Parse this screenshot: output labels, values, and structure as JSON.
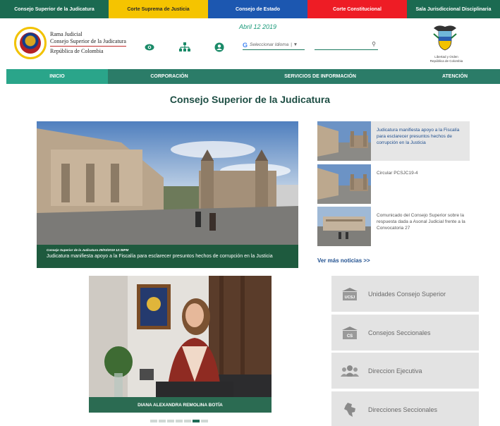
{
  "topbar": [
    {
      "label": "Consejo Superior de la Judicatura",
      "color": "#1b6a51"
    },
    {
      "label": "Corte Suprema de Justicia",
      "color": "#f5c400"
    },
    {
      "label": "Consejo de Estado",
      "color": "#1c57b0"
    },
    {
      "label": "Corte Constitucional",
      "color": "#ee1c25"
    },
    {
      "label": "Sala Jurisdiccional Disciplinaria",
      "color": "#1b6a51"
    }
  ],
  "header": {
    "brand_line1": "Rama Judicial",
    "brand_line2": "Consejo Superior de la Judicatura",
    "brand_line3": "República de Colombia",
    "date": "Abril 12 2019",
    "language_placeholder": "Seleccionar Idioma",
    "language_g": "G",
    "language_arrow": "| ▼",
    "search_icon": "⚲",
    "shield_caption_1": "Libertad y Orden",
    "shield_caption_2": "República de Colombia"
  },
  "nav": [
    "INICIO",
    "CORPORACIÓN",
    "SERVICIOS DE INFORMACIÓN",
    "ATENCIÓN"
  ],
  "page_title": "Consejo Superior de la Judicatura",
  "hero": {
    "meta": "Consejo Superior de la Judicatura    29/03/2019 12:38PM",
    "title": "Judicatura manifiesta apoyo a la Fiscalía para esclarecer presuntos hechos de corrupción en la Justicia"
  },
  "news": [
    {
      "text": "Judicatura manifiesta apoyo a la Fiscalía para esclarecer presuntos hechos de corrupción en la Justicia"
    },
    {
      "text": "Circular PCSJC19-4"
    },
    {
      "text": "Comunicado del Consejo Superior sobre la respuesta dada a Asonal Judicial frente a la Convocatoria 27"
    }
  ],
  "more_news": "Ver más noticias >>",
  "portrait_caption": "DIANA ALEXANDRA REMOLINA BOTÍA",
  "quick_links": [
    {
      "label": "Unidades Consejo Superior",
      "icon_text": "UCSJ"
    },
    {
      "label": "Consejos Seccionales",
      "icon_text": "CS"
    },
    {
      "label": "Direccion Ejecutiva",
      "icon_text": ""
    },
    {
      "label": "Direcciones Seccionales",
      "icon_text": ""
    }
  ],
  "carousel": {
    "count": 7,
    "active": 6
  }
}
